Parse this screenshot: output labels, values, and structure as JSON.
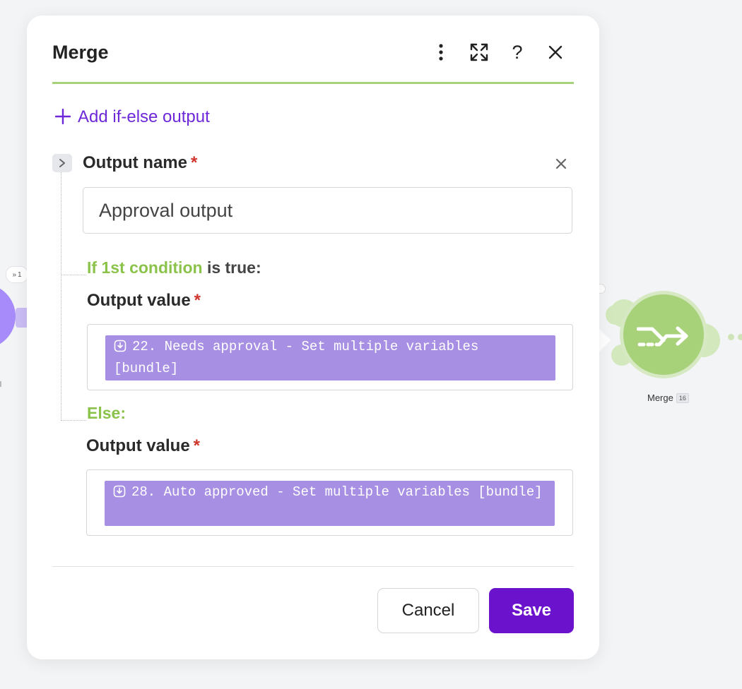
{
  "canvas": {
    "left_node_badge": "1",
    "merge_node_label": "Merge",
    "merge_node_id": "16"
  },
  "dialog": {
    "title": "Merge",
    "header_icons": [
      "more-vertical-icon",
      "expand-icon",
      "help-icon",
      "close-icon"
    ],
    "help_glyph": "?",
    "add_output_label": "Add if-else output",
    "output_name_label": "Output name",
    "required_mark": "*",
    "output_name_value": "Approval output",
    "condition": {
      "prefix": "If 1st condition",
      "suffix": "is true:"
    },
    "output_value_label": "Output value",
    "if_value_pill": "22. Needs approval - Set multiple variables [bundle]",
    "else_label": "Else:",
    "else_value_pill": "28. Auto approved - Set multiple variables [bundle]",
    "cancel_label": "Cancel",
    "save_label": "Save"
  },
  "colors": {
    "accent_purple": "#6a12cc",
    "pill_purple": "#a78fe4",
    "green": "#8bc34a",
    "required_red": "#d0342c",
    "merge_node_green": "#a8d27a"
  }
}
